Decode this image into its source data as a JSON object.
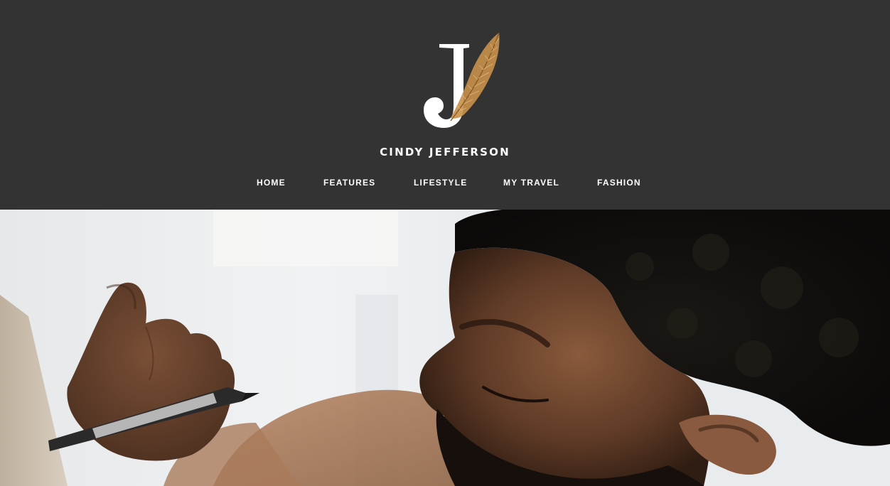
{
  "header": {
    "logo_letter": "J",
    "logo_icon": "feather-icon",
    "site_title": "CINDY JEFFERSON"
  },
  "nav": {
    "items": [
      {
        "label": "HOME"
      },
      {
        "label": "FEATURES"
      },
      {
        "label": "LIFESTYLE"
      },
      {
        "label": "MY TRAVEL"
      },
      {
        "label": "FASHION"
      }
    ]
  },
  "hero": {
    "image_subject": "man writing with marker"
  },
  "colors": {
    "header_bg": "#333333",
    "text": "#ffffff",
    "feather_accent": "#c8914b"
  }
}
